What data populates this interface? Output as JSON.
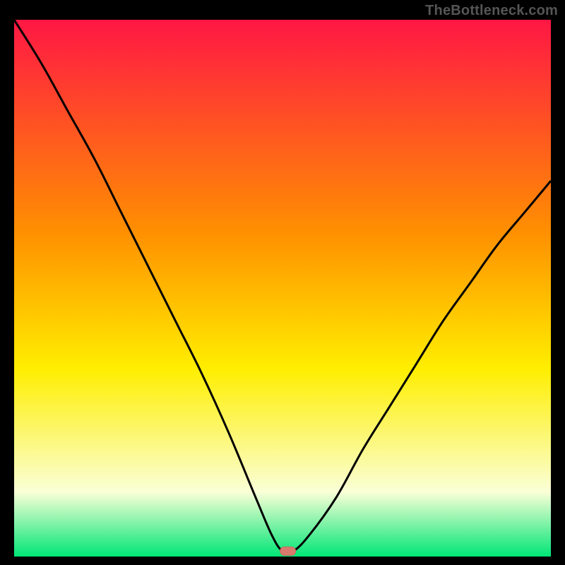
{
  "watermark": "TheBottleneck.com",
  "colors": {
    "bg": "#000000",
    "grad_top": "#ff1744",
    "grad_upper_mid": "#ff9100",
    "grad_mid": "#ffee00",
    "grad_lower_mid": "#faffd7",
    "grad_bottom": "#00e676",
    "curve": "#000000",
    "marker_fill": "#d97a6f",
    "marker_stroke": "#c96a5f"
  },
  "chart_data": {
    "type": "line",
    "title": "",
    "xlabel": "",
    "ylabel": "",
    "xlim": [
      0,
      100
    ],
    "ylim": [
      0,
      100
    ],
    "grid": false,
    "legend": false,
    "series": [
      {
        "name": "bottleneck-curve",
        "x": [
          0,
          5,
          10,
          15,
          20,
          25,
          30,
          35,
          40,
          45,
          48,
          50,
          52,
          55,
          60,
          65,
          70,
          75,
          80,
          85,
          90,
          95,
          100
        ],
        "y": [
          100,
          92,
          83,
          74,
          64,
          54,
          44,
          34,
          23,
          11,
          4,
          1,
          1,
          4,
          11,
          20,
          28,
          36,
          44,
          51,
          58,
          64,
          70
        ]
      }
    ],
    "marker": {
      "x": 51,
      "y": 1
    },
    "gradient_stops": [
      {
        "pos": 0.0,
        "color": "#ff1744"
      },
      {
        "pos": 0.4,
        "color": "#ff9100"
      },
      {
        "pos": 0.65,
        "color": "#ffee00"
      },
      {
        "pos": 0.88,
        "color": "#faffd7"
      },
      {
        "pos": 1.0,
        "color": "#00e676"
      }
    ]
  }
}
